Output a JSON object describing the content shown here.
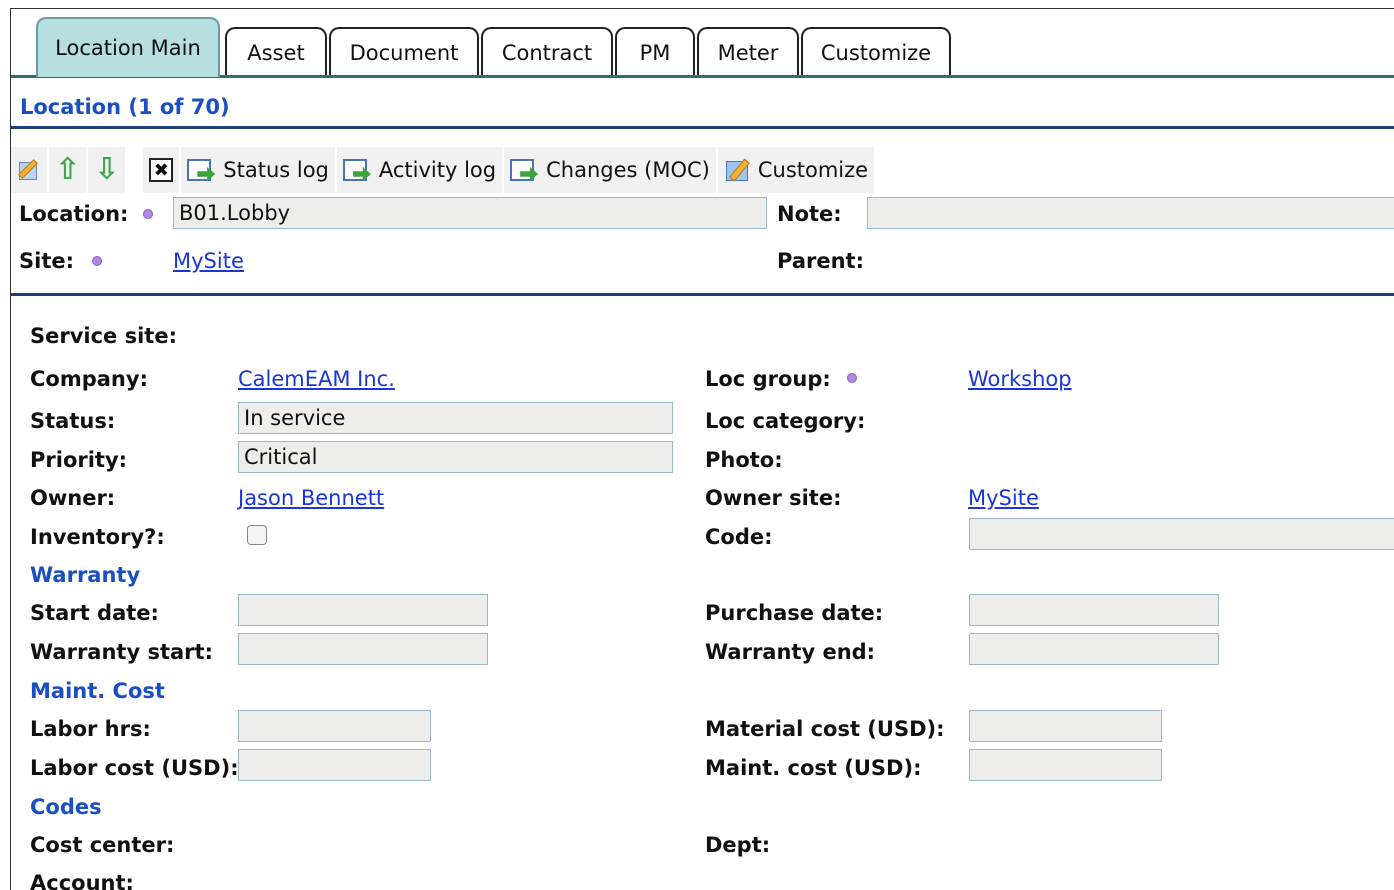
{
  "tabs": [
    {
      "label": "Location Main"
    },
    {
      "label": "Asset"
    },
    {
      "label": "Document"
    },
    {
      "label": "Contract"
    },
    {
      "label": "PM"
    },
    {
      "label": "Meter"
    },
    {
      "label": "Customize"
    }
  ],
  "header": {
    "title": "Location (1 of 70)"
  },
  "toolbar": {
    "edit_icon": "edit-icon",
    "up_icon": "arrow-up-icon",
    "down_icon": "arrow-down-icon",
    "close_icon": "close-icon",
    "status_log": "Status log",
    "activity_log": "Activity log",
    "changes": "Changes (MOC)",
    "customize": "Customize"
  },
  "top_fields": {
    "location_label": "Location:",
    "location_value": "B01.Lobby",
    "note_label": "Note:",
    "note_value": "",
    "site_label": "Site:",
    "site_value": "MySite",
    "parent_label": "Parent:"
  },
  "fields": {
    "service_site_label": "Service site:",
    "company_label": "Company:",
    "company_value": "CalemEAM Inc.",
    "loc_group_label": "Loc group:",
    "loc_group_value": "Workshop",
    "status_label": "Status:",
    "status_value": "In service",
    "loc_category_label": "Loc category:",
    "priority_label": "Priority:",
    "priority_value": "Critical",
    "photo_label": "Photo:",
    "owner_label": "Owner:",
    "owner_value": "Jason Bennett",
    "owner_site_label": "Owner site:",
    "owner_site_value": "MySite",
    "inventory_label": "Inventory?:",
    "inventory_checked": false,
    "code_label": "Code:",
    "code_value": ""
  },
  "warranty": {
    "section": "Warranty",
    "start_date_label": "Start date:",
    "purchase_date_label": "Purchase date:",
    "warranty_start_label": "Warranty start:",
    "warranty_end_label": "Warranty end:"
  },
  "maint_cost": {
    "section": "Maint. Cost",
    "labor_hrs_label": "Labor hrs:",
    "material_cost_label": "Material cost (USD):",
    "labor_cost_label": "Labor cost (USD):",
    "maint_cost_label": "Maint. cost (USD):"
  },
  "codes": {
    "section": "Codes",
    "cost_center_label": "Cost center:",
    "dept_label": "Dept:",
    "account_label": "Account:"
  },
  "colors": {
    "active_tab": "#b7dfe2",
    "section_title": "#1a4fc2",
    "link": "#1a35d8",
    "required_dot": "#b08ae0",
    "input_bg": "#ededeb"
  }
}
